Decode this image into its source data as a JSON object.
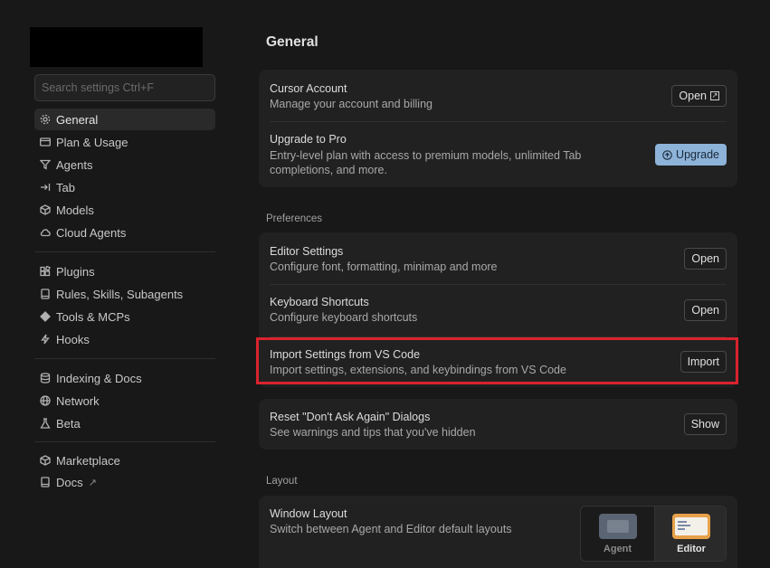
{
  "search": {
    "placeholder": "Search settings Ctrl+F"
  },
  "sidebar": {
    "items": [
      {
        "label": "General",
        "icon": "gear-icon"
      },
      {
        "label": "Plan & Usage",
        "icon": "card-icon"
      },
      {
        "label": "Agents",
        "icon": "agents-icon"
      },
      {
        "label": "Tab",
        "icon": "tab-arrow-icon"
      },
      {
        "label": "Models",
        "icon": "cube-icon"
      },
      {
        "label": "Cloud Agents",
        "icon": "cloud-icon"
      },
      {
        "label": "Plugins",
        "icon": "plugins-icon"
      },
      {
        "label": "Rules, Skills, Subagents",
        "icon": "book-icon"
      },
      {
        "label": "Tools & MCPs",
        "icon": "tools-icon"
      },
      {
        "label": "Hooks",
        "icon": "bolt-icon"
      },
      {
        "label": "Indexing & Docs",
        "icon": "database-icon"
      },
      {
        "label": "Network",
        "icon": "globe-icon"
      },
      {
        "label": "Beta",
        "icon": "flask-icon"
      },
      {
        "label": "Marketplace",
        "icon": "cube-icon"
      },
      {
        "label": "Docs",
        "icon": "book-icon",
        "external": "↗"
      }
    ]
  },
  "main": {
    "title": "General",
    "account": {
      "title": "Cursor Account",
      "desc": "Manage your account and billing",
      "button": "Open"
    },
    "pro": {
      "title": "Upgrade to Pro",
      "desc": "Entry-level plan with access to premium models, unlimited Tab completions, and more.",
      "button": "Upgrade"
    },
    "preferences_label": "Preferences",
    "editor": {
      "title": "Editor Settings",
      "desc": "Configure font, formatting, minimap and more",
      "button": "Open"
    },
    "keyboard": {
      "title": "Keyboard Shortcuts",
      "desc": "Configure keyboard shortcuts",
      "button": "Open"
    },
    "import": {
      "title": "Import Settings from VS Code",
      "desc": "Import settings, extensions, and keybindings from VS Code",
      "button": "Import"
    },
    "reset": {
      "title": "Reset \"Don't Ask Again\" Dialogs",
      "desc": "See warnings and tips that you've hidden",
      "button": "Show"
    },
    "layout_label": "Layout",
    "window_layout": {
      "title": "Window Layout",
      "desc": "Switch between Agent and Editor default layouts",
      "options": [
        "Agent",
        "Editor"
      ],
      "selected": "Editor"
    }
  },
  "colors": {
    "highlight": "#d9232e",
    "upgrade": "#8db3d9"
  }
}
